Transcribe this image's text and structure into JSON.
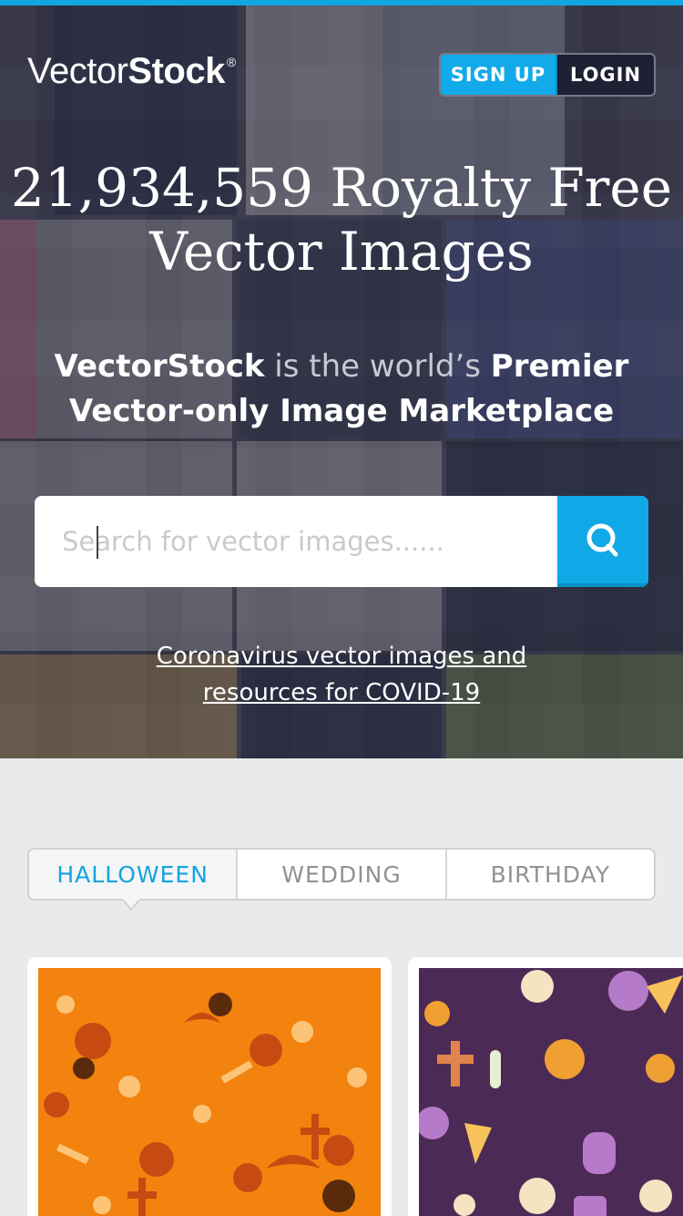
{
  "brand": {
    "name_part1": "Vector",
    "name_part2": "Stock",
    "mark": "®"
  },
  "auth": {
    "signup_label": "SIGN UP",
    "login_label": "LOGIN"
  },
  "hero": {
    "headline_line1": "21,934,559 Royalty Free",
    "headline_line2": "Vector Images",
    "tagline_brand": "VectorStock",
    "tagline_mid": " is the world’s ",
    "tagline_premier": "Premier",
    "tagline_line2": "Vector-only Image Marketplace"
  },
  "search": {
    "placeholder": "Search for vector images......",
    "icon": "search-icon"
  },
  "covid": {
    "line1": "Coronavirus vector images and",
    "line2": "resources for COVID-19"
  },
  "tabs": [
    {
      "label": "HALLOWEEN",
      "active": true
    },
    {
      "label": "WEDDING",
      "active": false
    },
    {
      "label": "BIRTHDAY",
      "active": false
    }
  ],
  "cards": [
    {
      "name": "halloween-orange-pattern"
    },
    {
      "name": "halloween-purple-pattern"
    }
  ],
  "colors": {
    "accent": "#10a8e6",
    "hero_overlay": "#3a3b4d",
    "page_bg": "#e9eaea",
    "orange": "#f2830f",
    "purple": "#4c2a56"
  }
}
